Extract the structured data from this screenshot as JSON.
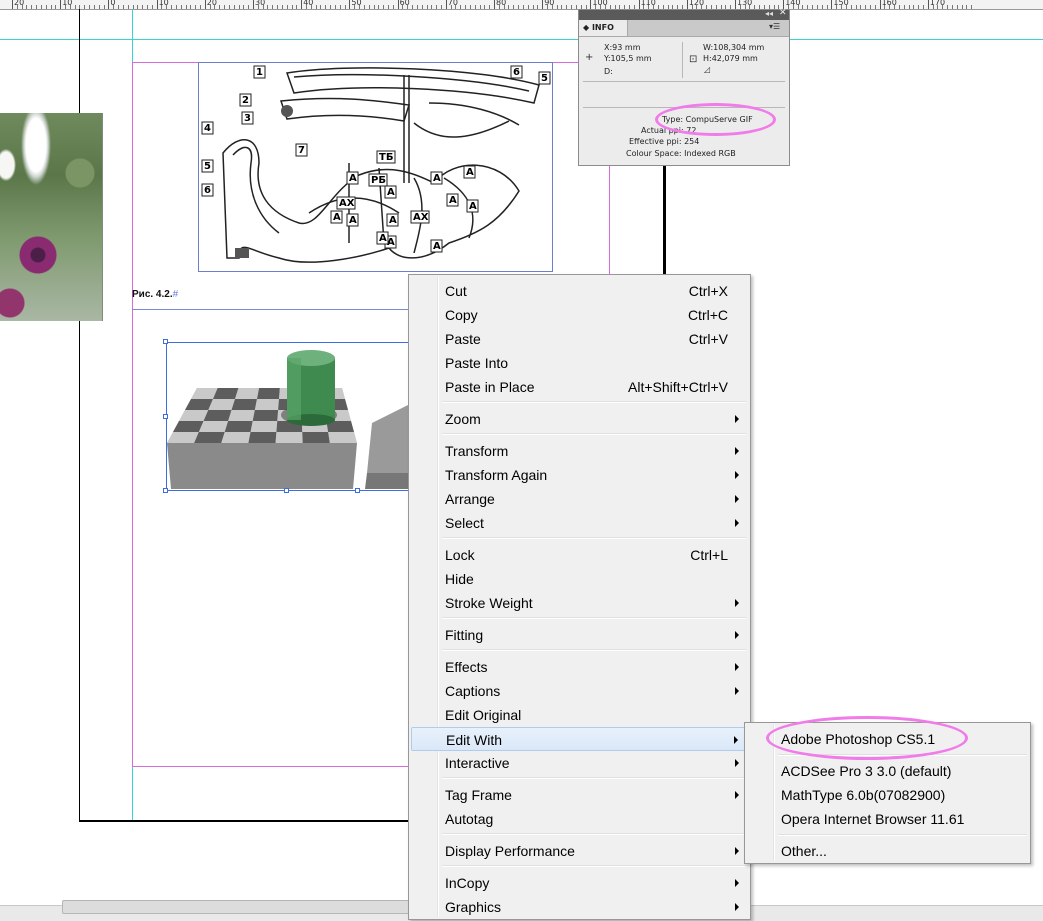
{
  "ruler": {
    "labels": [
      "20",
      "10",
      "0",
      "10",
      "20",
      "30",
      "40",
      "50",
      "60",
      "70",
      "80",
      "90",
      "100",
      "110",
      "120",
      "130",
      "140",
      "150",
      "160",
      "170"
    ]
  },
  "document": {
    "figure_caption": "Рис. 4.2.",
    "caption_marker": "#",
    "illustration_labels": [
      "1",
      "2",
      "3",
      "4",
      "5",
      "6",
      "7",
      "6",
      "5",
      "ТБ",
      "РБ",
      "А",
      "АХ",
      "А",
      "А",
      "А",
      "А",
      "А",
      "А",
      "АХ",
      "А",
      "А",
      "А",
      "А",
      "А"
    ]
  },
  "info_panel": {
    "tab_label": "INFO",
    "x": "X:93 mm",
    "y": "Y:105,5 mm",
    "d": "D:",
    "w": "W:108,304 mm",
    "h": "H:42,079 mm",
    "type": "Type: CompuServe GIF",
    "actual_ppi": "Actual ppi: 72",
    "effective_ppi": "Effective ppi: 254",
    "colour_space": "Colour Space: Indexed RGB"
  },
  "context_menu": {
    "cut": {
      "label": "Cut",
      "shortcut": "Ctrl+X"
    },
    "copy": {
      "label": "Copy",
      "shortcut": "Ctrl+C"
    },
    "paste": {
      "label": "Paste",
      "shortcut": "Ctrl+V"
    },
    "paste_into": {
      "label": "Paste Into"
    },
    "paste_in_place": {
      "label": "Paste in Place",
      "shortcut": "Alt+Shift+Ctrl+V"
    },
    "zoom": {
      "label": "Zoom"
    },
    "transform": {
      "label": "Transform"
    },
    "transform_again": {
      "label": "Transform Again"
    },
    "arrange": {
      "label": "Arrange"
    },
    "select": {
      "label": "Select"
    },
    "lock": {
      "label": "Lock",
      "shortcut": "Ctrl+L"
    },
    "hide": {
      "label": "Hide"
    },
    "stroke_weight": {
      "label": "Stroke Weight"
    },
    "fitting": {
      "label": "Fitting"
    },
    "effects": {
      "label": "Effects"
    },
    "captions": {
      "label": "Captions"
    },
    "edit_original": {
      "label": "Edit Original"
    },
    "edit_with": {
      "label": "Edit With"
    },
    "interactive": {
      "label": "Interactive"
    },
    "tag_frame": {
      "label": "Tag Frame"
    },
    "autotag": {
      "label": "Autotag"
    },
    "display_performance": {
      "label": "Display Performance"
    },
    "incopy": {
      "label": "InCopy"
    },
    "graphics": {
      "label": "Graphics"
    }
  },
  "edit_with_submenu": {
    "items": [
      "Adobe Photoshop CS5.1",
      "ACDSee Pro 3 3.0 (default)",
      "MathType 6.0b(07082900)",
      "Opera Internet Browser 11.61",
      "Other..."
    ]
  },
  "colors": {
    "guide": "#39d3d0",
    "margin": "#d86bd9",
    "highlight": "#f17be9",
    "menu_bg": "#f0f0f0",
    "menu_hover": "#dbe8f8"
  }
}
